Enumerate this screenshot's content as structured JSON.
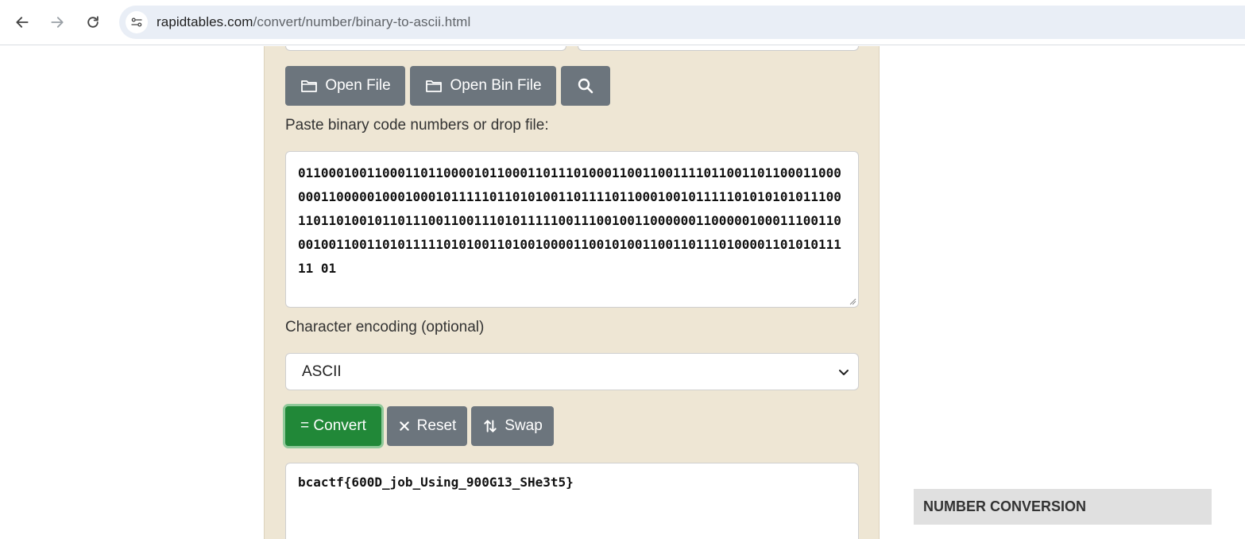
{
  "browser": {
    "url_domain": "rapidtables.com",
    "url_path": "/convert/number/binary-to-ascii.html"
  },
  "toolbar": {
    "open_file_label": "Open File",
    "open_bin_file_label": "Open Bin File"
  },
  "input": {
    "label": "Paste binary code numbers or drop file:",
    "value": "0110001001100011011000010110001101110100011001100111101100110110001100000011000001000100010111110110101001101111011000100101111101010101011100110110100101101110011001110101111100111001001100000011000001000111001100010011001101011111010100110100100001100101001100110111010000110101011111 01"
  },
  "encoding": {
    "label": "Character encoding (optional)",
    "selected": "ASCII"
  },
  "actions": {
    "convert_label": "= Convert",
    "reset_label": "Reset",
    "swap_label": "Swap"
  },
  "output": {
    "value": "bcactf{600D_job_Using_900G13_SHe3t5}"
  },
  "sidebar": {
    "heading": "NUMBER CONVERSION"
  },
  "colors": {
    "panel_bg": "#eee6d4",
    "button_gray": "#6c757d",
    "convert_green": "#218838"
  }
}
